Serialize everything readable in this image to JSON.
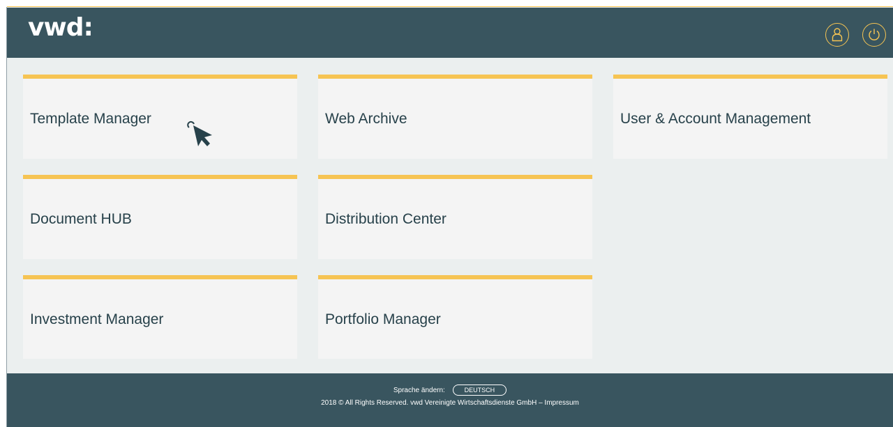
{
  "header": {
    "logo": "vwd:",
    "icons": {
      "user": "user-icon",
      "power": "power-icon"
    },
    "accent_color": "#f6c453",
    "background_color": "#39555f"
  },
  "tiles": [
    {
      "label": "Template Manager"
    },
    {
      "label": "Web Archive"
    },
    {
      "label": "User & Account Management"
    },
    {
      "label": "Document HUB"
    },
    {
      "label": "Distribution Center"
    },
    {
      "label": "Investment Manager"
    },
    {
      "label": "Portfolio Manager"
    }
  ],
  "footer": {
    "language_label": "Sprache ändern:",
    "language_button": "DEUTSCH",
    "copyright": "2018 © All Rights Reserved. vwd Vereinigte Wirtschaftsdienste GmbH – Impressum"
  }
}
